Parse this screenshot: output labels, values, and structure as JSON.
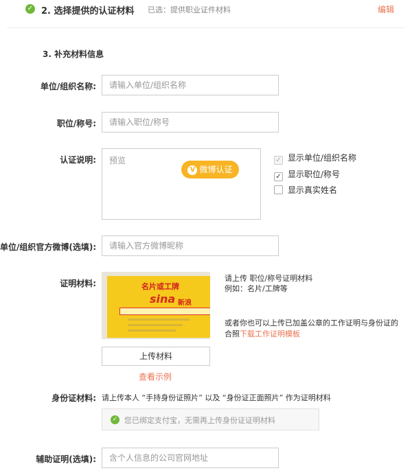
{
  "step2": {
    "title": "2. 选择提供的认证材料",
    "selected": "已选：提供职业证件材料",
    "edit_label": "编辑"
  },
  "section3": {
    "title": "3. 补充材料信息"
  },
  "fields": {
    "org_name": {
      "label": "单位/组织名称:",
      "placeholder": "请输入单位/组织名称"
    },
    "position": {
      "label": "职位/称号:",
      "placeholder": "请输入职位/称号"
    },
    "description": {
      "label": "认证说明:",
      "placeholder": "预览",
      "weibo_button": "微博认证"
    },
    "official_weibo": {
      "label": "单位/组织官方微博(选填):",
      "placeholder": "请输入官方微博昵称"
    },
    "aux_proof": {
      "label": "辅助证明(选填):",
      "placeholder": "含个人信息的公司官网地址"
    }
  },
  "display_options": [
    {
      "label": "显示单位/组织名称",
      "checked": true,
      "disabled": true
    },
    {
      "label": "显示职位/称号",
      "checked": true,
      "disabled": false
    },
    {
      "label": "显示真实姓名",
      "checked": false,
      "disabled": false
    }
  ],
  "proof": {
    "label": "证明材料:",
    "sample_caption": "名片或工牌",
    "sample_logo": "sina",
    "sample_logo_cn": "新浪",
    "tip_line1": "请上传 职位/称号证明材料",
    "tip_line2": "例如：名片/工牌等",
    "alt_tip": "或者你也可以上传已加盖公章的工作证明与身份证的合照",
    "template_link": "下载工作证明模板",
    "upload_button": "上传材料",
    "example_link": "查看示例"
  },
  "id_proof": {
    "label": "身份证材料:",
    "desc": "请上传本人 “手持身份证照片” 以及 “身份证正面照片” 作为证明材料",
    "bound_text": "您已绑定支付宝，无需再上传身份证证明材料"
  },
  "icons": {
    "check": "✓",
    "weibo_v": "V"
  },
  "colors": {
    "accent": "#eb7350",
    "success": "#71b83a",
    "weibo": "#f8b424"
  }
}
